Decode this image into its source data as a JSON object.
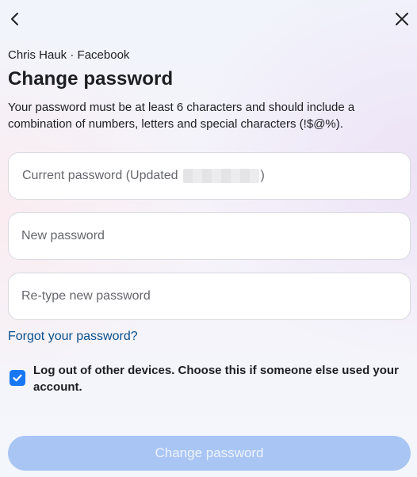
{
  "header": {
    "back_icon": "chevron-left-icon",
    "close_icon": "close-icon"
  },
  "account": {
    "name": "Chris Hauk",
    "separator": " · ",
    "platform": "Facebook"
  },
  "title": "Change password",
  "description": "Your password must be at least 6 characters and should include a combination of numbers, letters and special characters (!$@%).",
  "fields": {
    "current": {
      "placeholder_prefix": "Current password (Updated",
      "placeholder_suffix": ")",
      "value": ""
    },
    "new": {
      "placeholder": "New password",
      "value": ""
    },
    "retype": {
      "placeholder": "Re-type new password",
      "value": ""
    }
  },
  "forgot_link": "Forgot your password?",
  "logout_option": {
    "checked": true,
    "label": "Log out of other devices. Choose this if someone else used your account."
  },
  "submit_button": {
    "label": "Change password",
    "enabled": false
  },
  "colors": {
    "accent": "#1877f2",
    "link": "#0a4f8c",
    "button_disabled": "#a8c5f3"
  }
}
